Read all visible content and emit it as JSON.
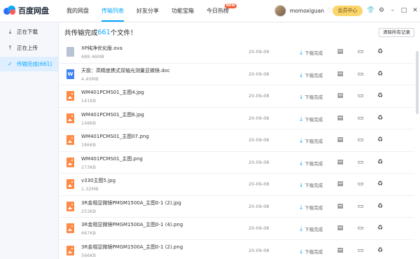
{
  "app": {
    "title": "百度网盘"
  },
  "nav": [
    {
      "label": "我的网盘",
      "active": false
    },
    {
      "label": "传输列表",
      "active": true
    },
    {
      "label": "好友分享",
      "active": false
    },
    {
      "label": "功能宝箱",
      "active": false
    },
    {
      "label": "今日热榜",
      "active": false,
      "badge": "NEW"
    }
  ],
  "user": {
    "name": "momoxiguan",
    "member_label": "会员中心"
  },
  "top_icons": [
    "shirt-icon",
    "gear-icon",
    "minimize-icon",
    "maximize-icon",
    "close-icon"
  ],
  "sidebar": [
    {
      "label": "正在下载",
      "icon": "download-icon",
      "active": false
    },
    {
      "label": "正在上传",
      "icon": "upload-icon",
      "active": false
    },
    {
      "label": "传输完成(661)",
      "icon": "check-circle-icon",
      "active": true
    }
  ],
  "main": {
    "header_prefix": "共传输完成",
    "count": "661",
    "header_suffix": "个文件！",
    "clear_label": "清除所有记录"
  },
  "files": [
    {
      "type": "ova",
      "name": "XP纯净优化版.ova",
      "size": "688.46MB",
      "date": "20-09-09",
      "status": "下载完成"
    },
    {
      "type": "doc",
      "name": "天极：高精度携式双轴光测量显微镜.doc",
      "size": "4.40MB",
      "date": "20-09-08",
      "status": "下载完成"
    },
    {
      "type": "img",
      "name": "WM401PCMS01_主图4.jpg",
      "size": "141KB",
      "date": "20-09-08",
      "status": "下载完成"
    },
    {
      "type": "img",
      "name": "WM401PCMS01_主图6.jpg",
      "size": "148KB",
      "date": "20-09-08",
      "status": "下载完成"
    },
    {
      "type": "img",
      "name": "WM401PCMS01_主图07.png",
      "size": "186KB",
      "date": "20-09-08",
      "status": "下载完成"
    },
    {
      "type": "img",
      "name": "WM401PCMS01_主图.png",
      "size": "273KB",
      "date": "20-09-08",
      "status": "下载完成"
    },
    {
      "type": "img",
      "name": "v330主图5.jpg",
      "size": "1.32MB",
      "date": "20-09-08",
      "status": "下载完成"
    },
    {
      "type": "img",
      "name": "3R金相显微镜PMGM1500A_主图0-1 (2).jpg",
      "size": "253KB",
      "date": "20-09-08",
      "status": "下载完成"
    },
    {
      "type": "img",
      "name": "3R金相显微镜PMGM1500A_主图0-1 (4).png",
      "size": "667KB",
      "date": "20-09-08",
      "status": "下载完成"
    },
    {
      "type": "img",
      "name": "3R金相显微镜PMGM1500A_主图0-1 (2).png",
      "size": "566KB",
      "date": "20-09-08",
      "status": "下载完成"
    }
  ],
  "colors": {
    "accent": "#06a7ff",
    "member": "#fad56b",
    "image_file": "#ff8a45",
    "doc_file": "#3d82f6"
  }
}
